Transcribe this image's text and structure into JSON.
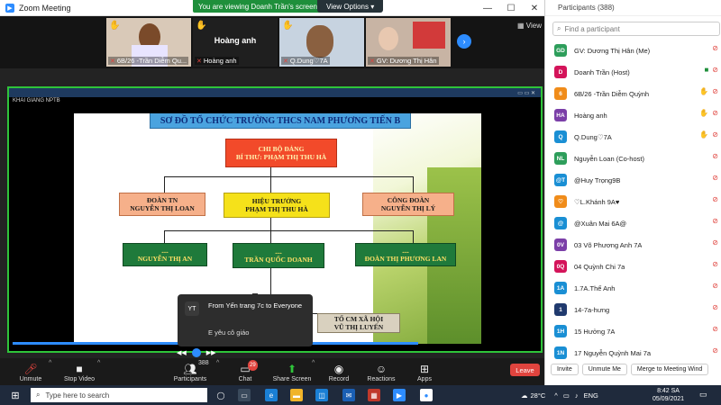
{
  "window": {
    "title": "Zoom Meeting"
  },
  "banner": {
    "viewing": "You are viewing Doanh Trần's screen",
    "view_options": "View Options"
  },
  "gallery": {
    "tiles": [
      {
        "name": "6B/26 -Trần Diễm Qu..."
      },
      {
        "name": "Hoàng anh",
        "display": "Hoàng anh"
      },
      {
        "name": "Q.Dung♡7A"
      },
      {
        "name": "GV: Dương Thị Hân"
      }
    ],
    "view_label": "View"
  },
  "share": {
    "window_label": "KHAI GIANG NPTB"
  },
  "slide": {
    "title": "SƠ ĐỒ TỔ CHỨC TRƯỜNG THCS NAM PHƯƠNG TIẾN B",
    "chi_bo_1": "CHI BỘ ĐẢNG",
    "chi_bo_2": "BÍ THƯ: PHẠM THỊ THU HÀ",
    "doan_tn_1": "ĐOÀN TN",
    "doan_tn_2": "NGUYỄN THỊ LOAN",
    "hieu_truong_1": "HIỆU TRƯỞNG",
    "hieu_truong_2": "PHẠM THỊ THU HÀ",
    "cong_doan_1": "CÔNG ĐOÀN",
    "cong_doan_2": "NGUYỄN THỊ LÝ",
    "g1_1": "....",
    "g1_2": "NGUYỄN THỊ AN",
    "g2_1": "....",
    "g2_2": "TRẦN QUỐC DOANH",
    "g3_1": "....",
    "g3_2": "ĐOÀN THỊ PHƯƠNG LAN",
    "to_cm_1": "TỔ CM XÃ HỘI",
    "to_cm_2": "VŨ THỊ LUYẾN"
  },
  "chat": {
    "initials": "YT",
    "from": "From Yến trang 7c to Everyone",
    "message": "E yêu cô giáo"
  },
  "toolbar": {
    "unmute": "Unmute",
    "stop_video": "Stop Video",
    "participants": "Participants",
    "participants_count": "388",
    "chat": "Chat",
    "chat_badge": "29",
    "share_screen": "Share Screen",
    "record": "Record",
    "reactions": "Reactions",
    "apps": "Apps",
    "leave": "Leave"
  },
  "panel": {
    "title": "Participants (388)",
    "search_placeholder": "Find a participant",
    "participants": [
      {
        "initials": "GD",
        "color": "#2e9e5b",
        "name": "GV: Dương Thị Hân (Me)",
        "hand": false,
        "video": false
      },
      {
        "initials": "D",
        "color": "#d4145a",
        "name": "Doanh Trần (Host)",
        "hand": false,
        "video": true
      },
      {
        "initials": "6",
        "color": "#f08c1a",
        "name": "6B/26 -Trần Diễm Quỳnh",
        "hand": true,
        "video": false
      },
      {
        "initials": "HA",
        "color": "#7b3fa8",
        "name": "Hoàng anh",
        "hand": true,
        "video": false
      },
      {
        "initials": "Q",
        "color": "#1a8fd4",
        "name": "Q.Dung♡7A",
        "hand": true,
        "video": false
      },
      {
        "initials": "NL",
        "color": "#2e9e5b",
        "name": "Nguyễn Loan (Co-host)",
        "hand": false,
        "video": false
      },
      {
        "initials": "@T",
        "color": "#1a8fd4",
        "name": "@Huy Trọng9B",
        "hand": false,
        "video": false
      },
      {
        "initials": "♡",
        "color": "#f08c1a",
        "name": "♡L.Khánh 9A♥",
        "hand": false,
        "video": false
      },
      {
        "initials": "@",
        "color": "#1a8fd4",
        "name": "@Xuân Mai 6A@",
        "hand": false,
        "video": false
      },
      {
        "initials": "0V",
        "color": "#7b3fa8",
        "name": "03 Võ Phương Anh 7A",
        "hand": false,
        "video": false
      },
      {
        "initials": "0Q",
        "color": "#d4145a",
        "name": "04 Quỳnh Chi 7a",
        "hand": false,
        "video": false
      },
      {
        "initials": "1A",
        "color": "#1a8fd4",
        "name": "1.7A.Thế Anh",
        "hand": false,
        "video": false
      },
      {
        "initials": "1",
        "color": "#203a6e",
        "name": "14-7a-hưng",
        "hand": false,
        "video": false
      },
      {
        "initials": "1H",
        "color": "#1a8fd4",
        "name": "15 Hưởng 7A",
        "hand": false,
        "video": false
      },
      {
        "initials": "1N",
        "color": "#1a8fd4",
        "name": "17 Nguyễn Quỳnh Mai 7a",
        "hand": false,
        "video": false
      }
    ],
    "invite": "Invite",
    "unmute_me": "Unmute Me",
    "merge": "Merge to Meeting Wind"
  },
  "taskbar": {
    "search": "Type here to search",
    "temp": "28°C",
    "lang": "ENG",
    "time": "8:42 SA",
    "date": "05/09/2021"
  }
}
